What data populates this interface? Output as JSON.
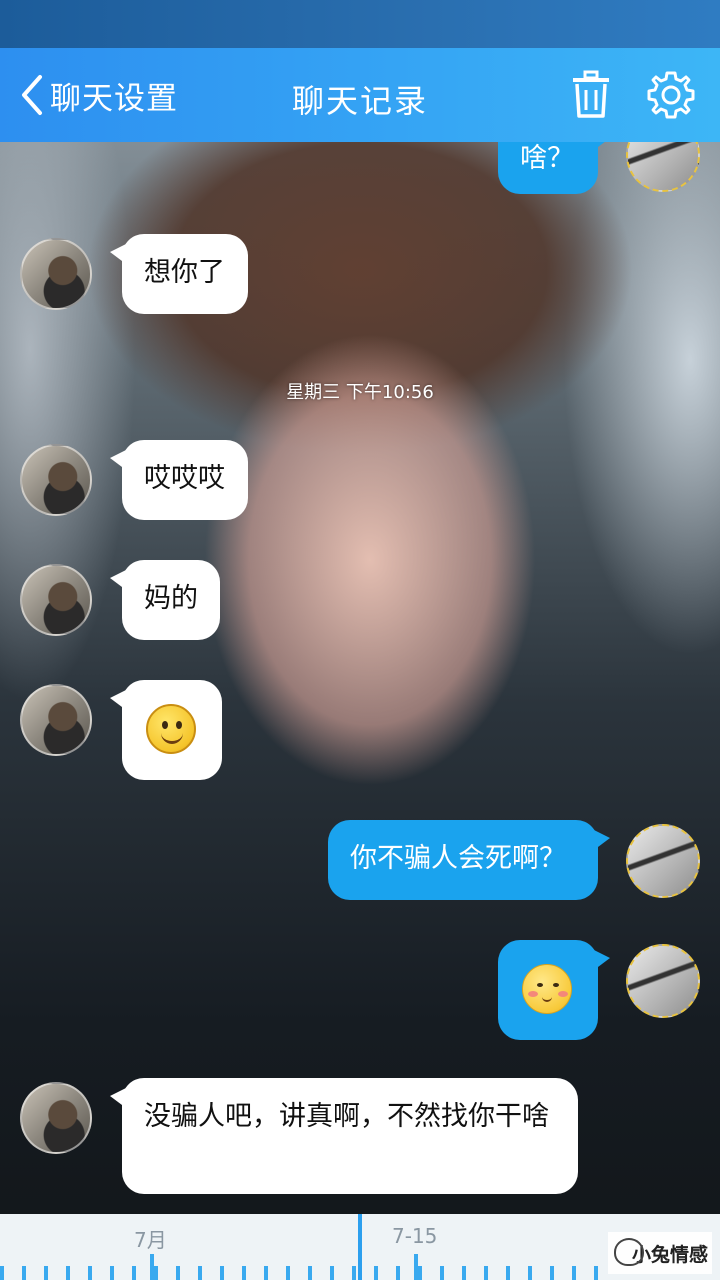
{
  "header": {
    "back_label": "聊天设置",
    "title": "聊天记录"
  },
  "chat": {
    "timestamp": "星期三 下午10:56",
    "messages": [
      {
        "side": "right",
        "text": "啥？"
      },
      {
        "side": "left",
        "text": "想你了"
      },
      {
        "side": "left",
        "text": "哎哎哎"
      },
      {
        "side": "left",
        "text": "妈的"
      },
      {
        "side": "left",
        "emoji": "smile-emoji"
      },
      {
        "side": "right",
        "text": "你不骗人会死啊？"
      },
      {
        "side": "right",
        "emoji": "blush-emoji"
      },
      {
        "side": "left",
        "text": "没骗人吧，讲真啊，不然找你干啥"
      }
    ]
  },
  "timeline": {
    "label_month": "7月",
    "label_date": "7-15"
  },
  "watermark": {
    "text": "小兔情感"
  },
  "colors": {
    "header_blue": "#35a4f4",
    "outgoing_bubble": "#1aa3ee",
    "incoming_bubble": "#ffffff"
  }
}
